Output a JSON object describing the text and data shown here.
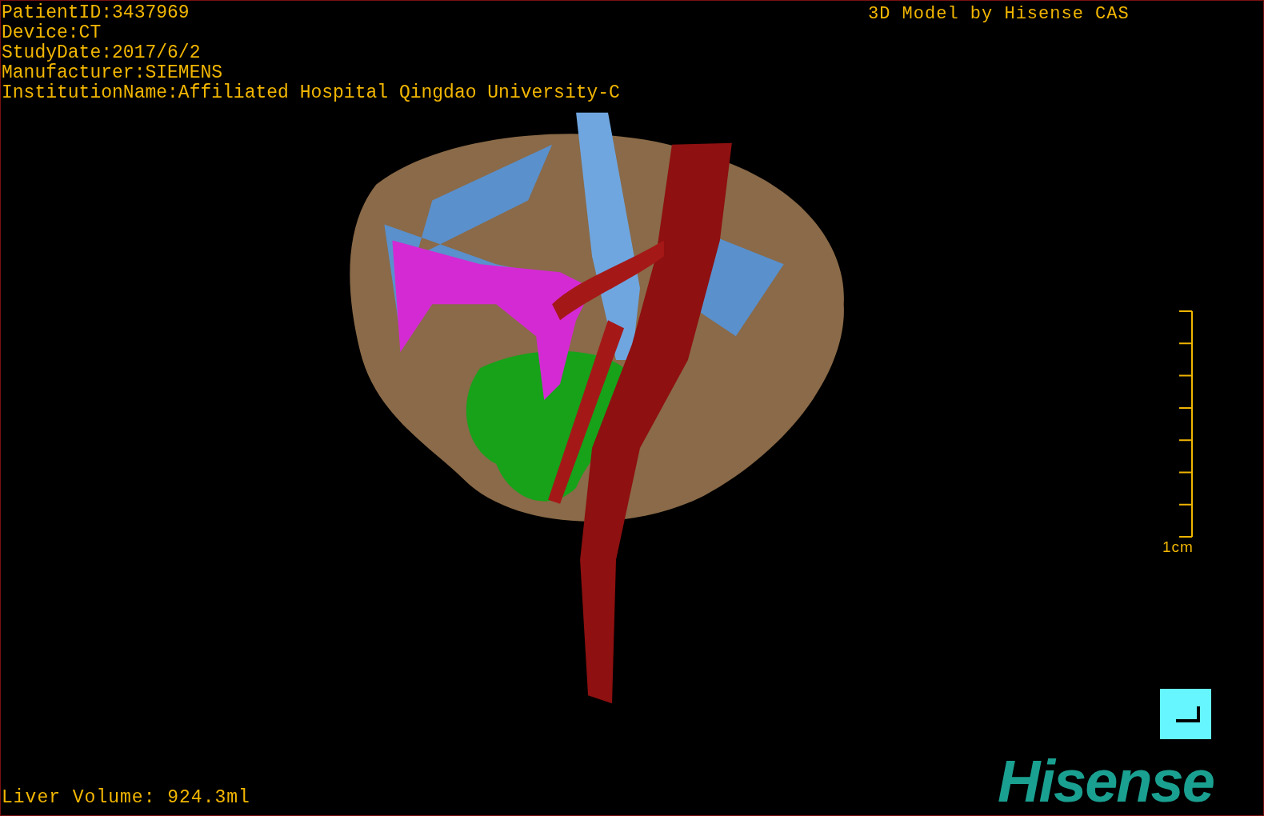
{
  "study_info": [
    "PatientID:3437969",
    "Device:CT",
    "StudyDate:2017/6/2",
    "Manufacturer:SIEMENS",
    "InstitutionName:Affiliated Hospital Qingdao University-C"
  ],
  "model_caption": "3D Model by Hisense CAS",
  "scale_bar": {
    "label": "1cm"
  },
  "measurement": "Liver Volume: 924.3ml",
  "logo": "Hisense"
}
